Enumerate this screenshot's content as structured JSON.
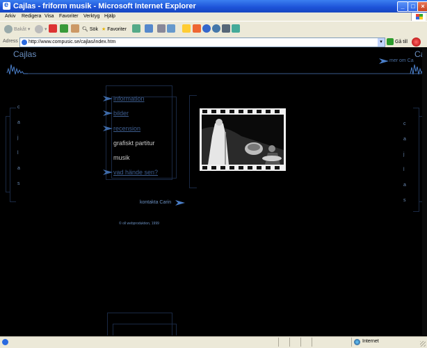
{
  "window": {
    "title": "Cajlas - friform musik - Microsoft Internet Explorer"
  },
  "menu": [
    "Arkiv",
    "Redigera",
    "Visa",
    "Favoriter",
    "Verktyg",
    "Hjälp"
  ],
  "toolbar": {
    "back": "Bakåt",
    "search": "Sök",
    "favorites": "Favoriter"
  },
  "address": {
    "label": "Adress",
    "url": "http://www.compusic.se/cajlas/index.htm",
    "go": "Gå till"
  },
  "page": {
    "brand": "Cajlas",
    "brand_right": "Ca",
    "more_link": "mer om Ca",
    "nav": [
      {
        "label": "information",
        "link": true
      },
      {
        "label": "bilder",
        "link": true
      },
      {
        "label": "recension",
        "link": true
      },
      {
        "label": "grafiskt partitur",
        "link": false
      },
      {
        "label": "musik",
        "link": false
      },
      {
        "label": "vad hände sen?",
        "link": true
      }
    ],
    "contact": "kontakta Carin",
    "copyright": "© oll webproduktion, 1999",
    "side_letters_left": [
      "c",
      "a",
      "j",
      "l",
      "a",
      "s"
    ],
    "side_letters_right": [
      "c",
      "a",
      "j",
      "l",
      "a",
      "s"
    ]
  },
  "status": {
    "zone": "Internet"
  },
  "colors": {
    "link": "#3e5e90",
    "accent": "#4a7ec8",
    "frame": "#1a2944"
  }
}
